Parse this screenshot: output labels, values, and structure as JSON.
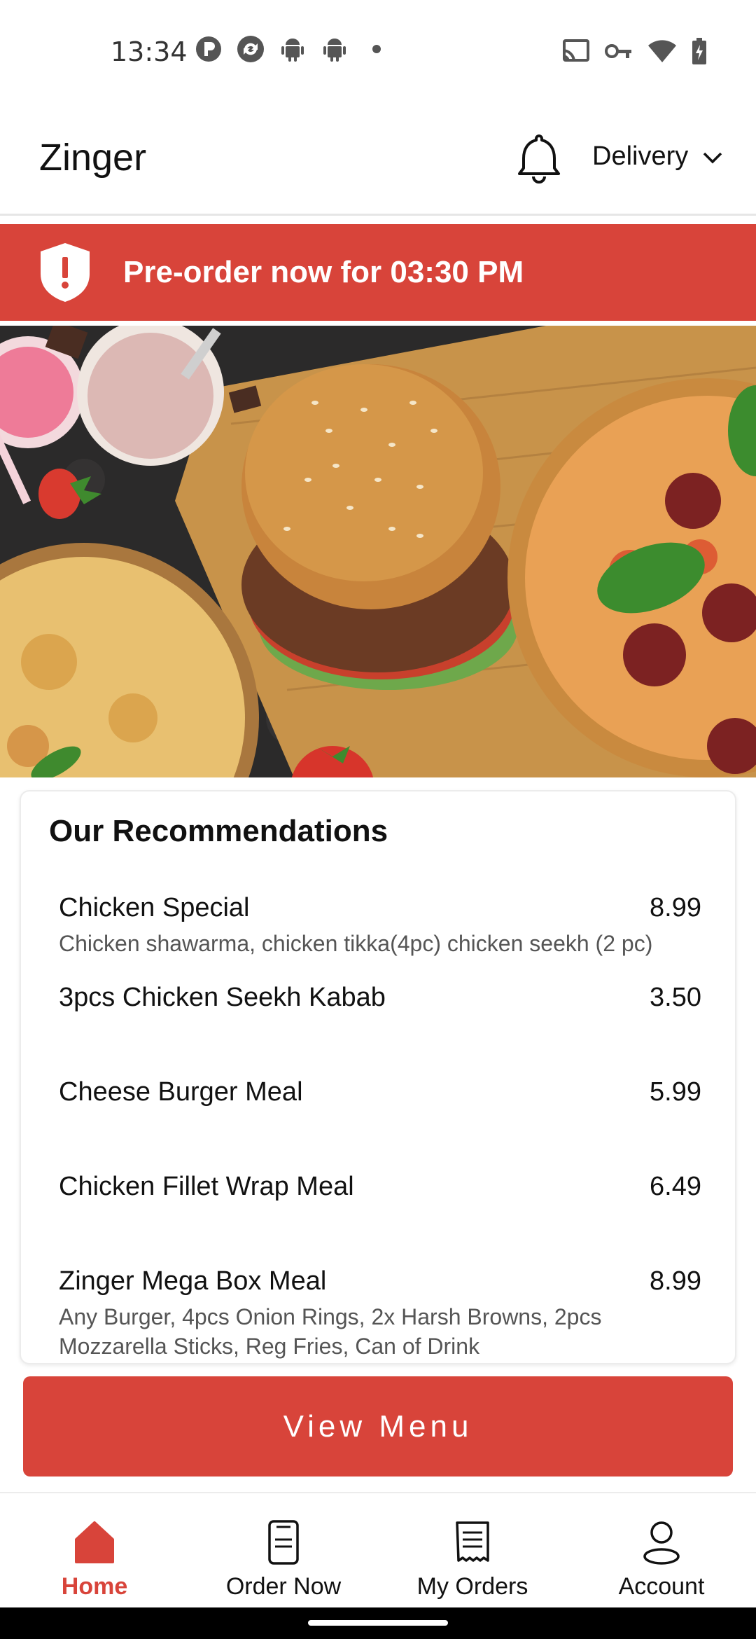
{
  "status_bar": {
    "time": "13:34",
    "left_icons": [
      "p-app-icon",
      "sync-app-icon",
      "android-icon",
      "android-icon",
      "dot-icon"
    ],
    "right_icons": [
      "cast-icon",
      "vpn-key-icon",
      "wifi-icon",
      "battery-charging-icon"
    ]
  },
  "header": {
    "title": "Zinger",
    "notification_icon": "bell-icon",
    "mode_label": "Delivery",
    "mode_icon": "chevron-down-icon"
  },
  "banner": {
    "icon": "shield-alert-icon",
    "text": "Pre-order now for 03:30 PM",
    "color": "#d8443a"
  },
  "recommendations": {
    "title": "Our Recommendations",
    "items": [
      {
        "name": "Chicken Special",
        "price": "8.99",
        "description": "Chicken shawarma, chicken tikka(4pc) chicken seekh (2 pc)"
      },
      {
        "name": "3pcs Chicken Seekh Kabab",
        "price": "3.50",
        "description": ""
      },
      {
        "name": "Cheese Burger Meal",
        "price": "5.99",
        "description": ""
      },
      {
        "name": "Chicken Fillet Wrap Meal",
        "price": "6.49",
        "description": ""
      },
      {
        "name": "Zinger Mega Box Meal",
        "price": "8.99",
        "description": "Any Burger, 4pcs Onion Rings, 2x Harsh Browns, 2pcs Mozzarella Sticks, Reg Fries, Can of Drink"
      }
    ]
  },
  "view_menu_label": "View Menu",
  "bottom_nav": [
    {
      "label": "Home",
      "icon": "home-icon",
      "active": true
    },
    {
      "label": "Order Now",
      "icon": "order-phone-icon",
      "active": false
    },
    {
      "label": "My Orders",
      "icon": "receipt-icon",
      "active": false
    },
    {
      "label": "Account",
      "icon": "user-icon",
      "active": false
    }
  ],
  "colors": {
    "accent": "#d8443a",
    "text": "#111111",
    "muted": "#555555"
  }
}
